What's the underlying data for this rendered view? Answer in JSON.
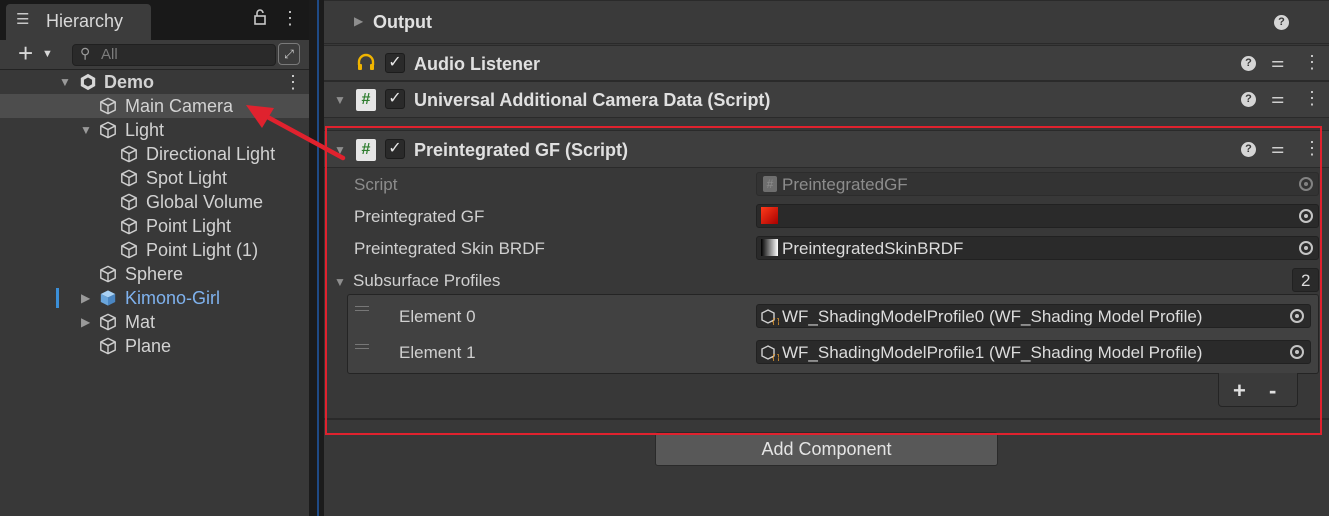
{
  "hierarchy": {
    "tab_label": "Hierarchy",
    "tab_icon": "☰",
    "search_placeholder": "All",
    "add_button": "+",
    "tree": [
      {
        "label": "Demo",
        "indent": 0,
        "expanded": true,
        "icon": "unity-scene-icon",
        "bold": true
      },
      {
        "label": "Main Camera",
        "indent": 1,
        "icon": "gameobject-cube-icon",
        "selected": true
      },
      {
        "label": "Light",
        "indent": 1,
        "expanded": true,
        "icon": "gameobject-cube-icon"
      },
      {
        "label": "Directional Light",
        "indent": 2,
        "icon": "gameobject-cube-icon"
      },
      {
        "label": "Spot Light",
        "indent": 2,
        "icon": "gameobject-cube-icon"
      },
      {
        "label": "Global Volume",
        "indent": 2,
        "icon": "gameobject-cube-icon"
      },
      {
        "label": "Point Light",
        "indent": 2,
        "icon": "gameobject-cube-icon"
      },
      {
        "label": "Point Light (1)",
        "indent": 2,
        "icon": "gameobject-cube-icon"
      },
      {
        "label": "Sphere",
        "indent": 1,
        "icon": "gameobject-cube-icon"
      },
      {
        "label": "Kimono-Girl",
        "indent": 1,
        "collapsed": true,
        "icon": "prefab-cube-icon",
        "color": "#7fb2ee"
      },
      {
        "label": "Mat",
        "indent": 1,
        "collapsed": true,
        "icon": "gameobject-cube-icon"
      },
      {
        "label": "Plane",
        "indent": 1,
        "icon": "gameobject-cube-icon"
      }
    ]
  },
  "inspector": {
    "components": [
      {
        "title": "Output",
        "has_checkbox": false
      },
      {
        "title": "Audio Listener",
        "icon": "headphones-icon",
        "checked": true
      },
      {
        "title": "Universal Additional Camera Data (Script)",
        "icon": "script-hash-icon",
        "checked": true
      },
      {
        "title": "Preintegrated GF (Script)",
        "icon": "script-hash-icon",
        "checked": true
      }
    ],
    "preintegrated": {
      "script_label": "Script",
      "script_value": "PreintegratedGF",
      "gf_label": "Preintegrated GF",
      "gf_value": "",
      "skin_label": "Preintegrated Skin BRDF",
      "skin_value": "PreintegratedSkinBRDF",
      "profiles_label": "Subsurface Profiles",
      "profiles_count": "2",
      "elements": [
        {
          "label": "Element 0",
          "value": "WF_ShadingModelProfile0 (WF_Shading Model Profile)"
        },
        {
          "label": "Element 1",
          "value": "WF_ShadingModelProfile1 (WF_Shading Model Profile)"
        }
      ],
      "add_label": "+",
      "remove_label": "-"
    },
    "add_component_label": "Add Component"
  },
  "colors": {
    "highlight_box": "#e0222e",
    "annotation_arrow": "#e0222e",
    "prefab_text": "#7fb2ee"
  }
}
